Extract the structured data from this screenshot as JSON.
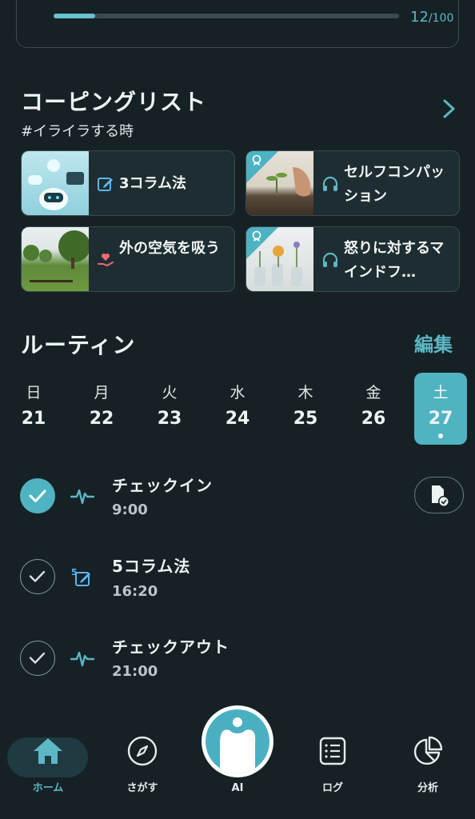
{
  "progress": {
    "current": "12",
    "total": "/100",
    "fraction": 0.12
  },
  "coping": {
    "title": "コーピングリスト",
    "subtitle": "#イライラする時",
    "cards": [
      {
        "label": "3コラム法",
        "icon": "edit-icon"
      },
      {
        "label": "セルフコンパッション",
        "icon": "headphones-icon",
        "badge": true
      },
      {
        "label": "外の空気を吸う",
        "icon": "heart-hand-icon"
      },
      {
        "label": "怒りに対するマインドフ…",
        "icon": "headphones-icon",
        "badge": true
      }
    ]
  },
  "routine": {
    "title": "ルーティン",
    "edit_label": "編集",
    "days": [
      {
        "name": "日",
        "date": "21"
      },
      {
        "name": "月",
        "date": "22"
      },
      {
        "name": "火",
        "date": "23"
      },
      {
        "name": "水",
        "date": "24"
      },
      {
        "name": "木",
        "date": "25"
      },
      {
        "name": "金",
        "date": "26"
      },
      {
        "name": "土",
        "date": "27",
        "selected": true
      }
    ],
    "items": [
      {
        "title": "チェックイン",
        "time": "9:00",
        "done": true,
        "icon": "pulse-icon"
      },
      {
        "title": "5コラム法",
        "time": "16:20",
        "done": false,
        "icon": "five-column-edit-icon"
      },
      {
        "title": "チェックアウト",
        "time": "21:00",
        "done": false,
        "icon": "pulse-icon"
      }
    ]
  },
  "nav": {
    "home": "ホーム",
    "search": "さがす",
    "ai": "AI",
    "log": "ログ",
    "analysis": "分析"
  },
  "colors": {
    "accent": "#4fb3c2",
    "background": "#152125",
    "card": "#1e2d31"
  }
}
